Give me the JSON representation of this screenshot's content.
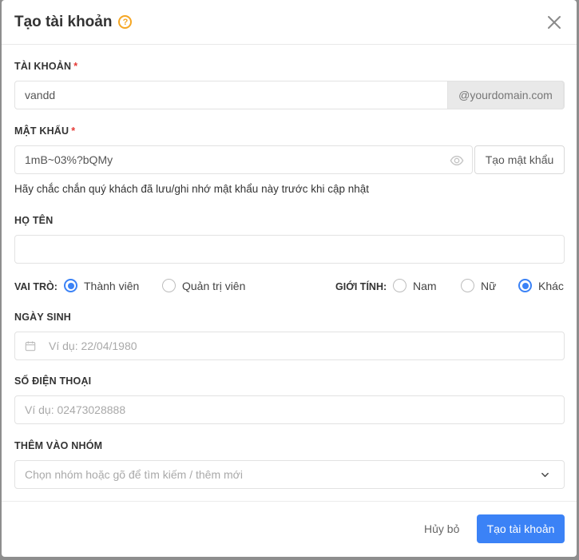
{
  "modal": {
    "title": "Tạo tài khoản",
    "help_icon": "?"
  },
  "account": {
    "label": "TÀI KHOẢN",
    "required_mark": "*",
    "value": "vandd",
    "domain_suffix": "@yourdomain.com"
  },
  "password": {
    "label": "MẬT KHẨU",
    "required_mark": "*",
    "value": "1mB~03%?bQMy",
    "generate_label": "Tạo mật khẩu",
    "hint": "Hãy chắc chắn quý khách đã lưu/ghi nhớ mật khẩu này trước khi cập nhật"
  },
  "fullname": {
    "label": "HỌ TÊN",
    "value": ""
  },
  "role": {
    "label": "VAI TRÒ:",
    "options": [
      "Thành viên",
      "Quản trị viên"
    ],
    "selected": "Thành viên"
  },
  "gender": {
    "label": "GIỚI TÍNH:",
    "options": [
      "Nam",
      "Nữ",
      "Khác"
    ],
    "selected": "Khác"
  },
  "birthday": {
    "label": "NGÀY SINH",
    "placeholder": "Ví dụ: 22/04/1980"
  },
  "phone": {
    "label": "SỐ ĐIỆN THOẠI",
    "placeholder": "Ví dụ: 02473028888"
  },
  "group": {
    "label": "THÊM VÀO NHÓM",
    "placeholder": "Chọn nhóm hoặc gõ để tìm kiếm / thêm mới"
  },
  "footer": {
    "cancel_label": "Hủy bỏ",
    "submit_label": "Tạo tài khoản"
  },
  "colors": {
    "accent": "#3b82f6",
    "required": "#e53935",
    "help": "#f5a623"
  },
  "icons": {
    "help": "help-circle-icon",
    "close": "close-icon",
    "password_visibility": "eye-icon",
    "birthday": "calendar-icon",
    "group_dropdown": "chevron-down-icon"
  }
}
